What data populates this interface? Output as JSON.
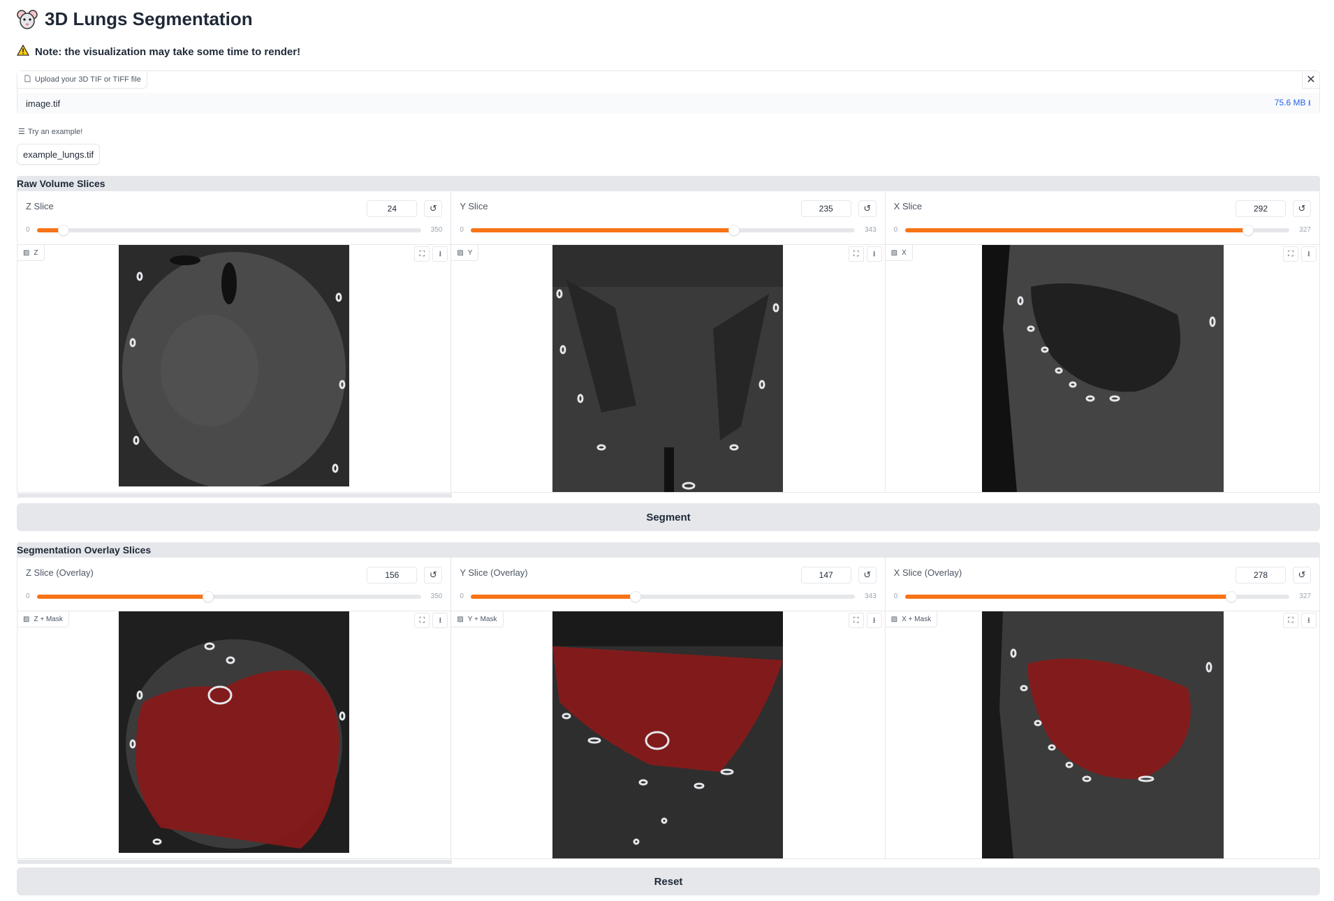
{
  "header": {
    "logo_icon": "mouse-icon",
    "title": "3D Lungs Segmentation",
    "note_icon": "warning-icon",
    "note": "Note: the visualization may take some time to render!"
  },
  "upload": {
    "label": "Upload your 3D TIF or TIFF file",
    "file_name": "image.tif",
    "file_size": "75.6 MB ⭳"
  },
  "examples": {
    "label": "Try an example!",
    "items": [
      "example_lungs.tif"
    ]
  },
  "raw": {
    "title": "Raw Volume Slices",
    "panels": [
      {
        "slider_label": "Z Slice",
        "value": "24",
        "min": "0",
        "max": "350",
        "fraction": 0.069,
        "image_label": "Z"
      },
      {
        "slider_label": "Y Slice",
        "value": "235",
        "min": "0",
        "max": "343",
        "fraction": 0.685,
        "image_label": "Y"
      },
      {
        "slider_label": "X Slice",
        "value": "292",
        "min": "0",
        "max": "327",
        "fraction": 0.893,
        "image_label": "X"
      }
    ]
  },
  "segment_button": "Segment",
  "overlay": {
    "title": "Segmentation Overlay Slices",
    "panels": [
      {
        "slider_label": "Z Slice (Overlay)",
        "value": "156",
        "min": "0",
        "max": "350",
        "fraction": 0.446,
        "image_label": "Z + Mask"
      },
      {
        "slider_label": "Y Slice (Overlay)",
        "value": "147",
        "min": "0",
        "max": "343",
        "fraction": 0.429,
        "image_label": "Y + Mask"
      },
      {
        "slider_label": "X Slice (Overlay)",
        "value": "278",
        "min": "0",
        "max": "327",
        "fraction": 0.85,
        "image_label": "X + Mask"
      }
    ]
  },
  "reset_button": "Reset",
  "colors": {
    "accent": "#f97316",
    "mask": "#b91c1c",
    "link": "#2563eb"
  }
}
